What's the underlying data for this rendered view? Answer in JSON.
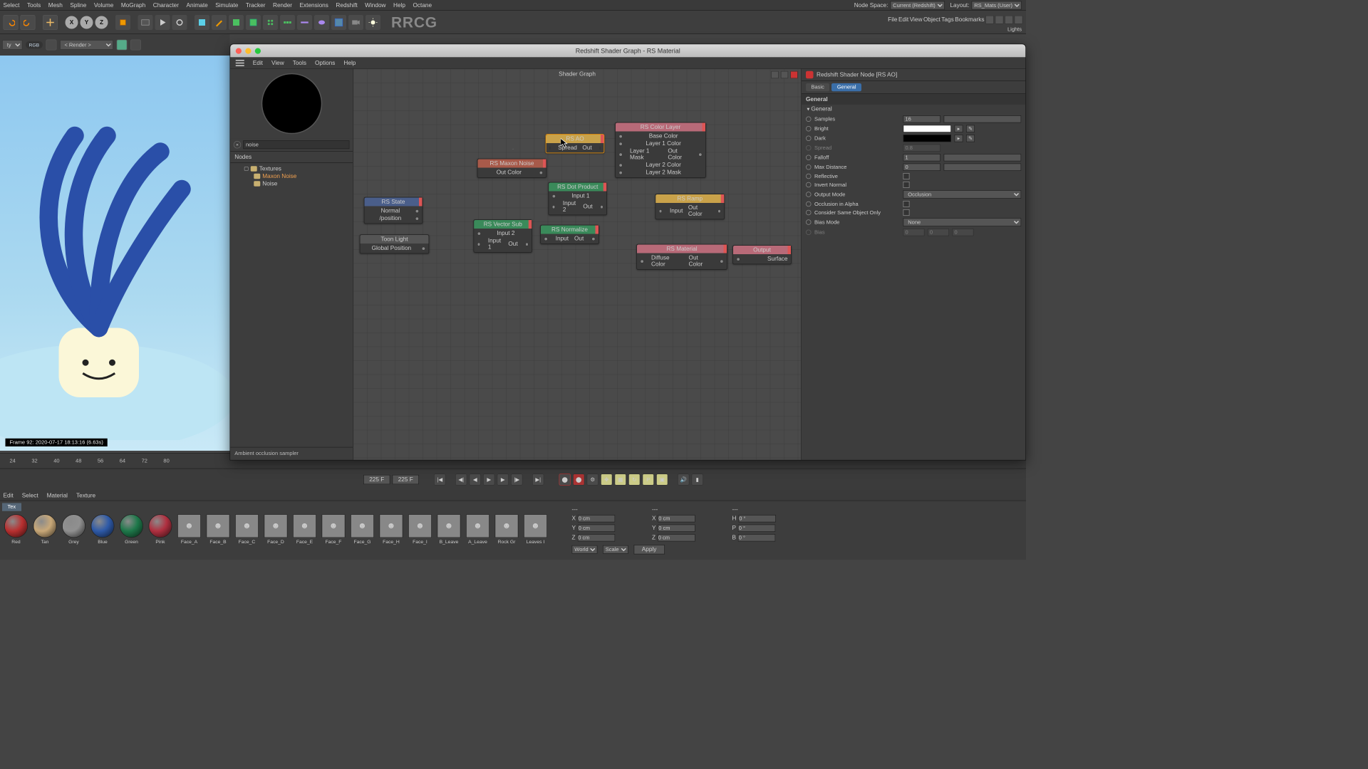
{
  "main_menu": [
    "Select",
    "Tools",
    "Mesh",
    "Spline",
    "Volume",
    "MoGraph",
    "Character",
    "Animate",
    "Simulate",
    "Tracker",
    "Render",
    "Extensions",
    "Redshift",
    "Window",
    "Help",
    "Octane"
  ],
  "top_right": {
    "node_space_label": "Node Space:",
    "node_space_value": "Current (Redshift)",
    "layout_label": "Layout:",
    "layout_value": "RS_Mats (User)"
  },
  "obj_menu": [
    "File",
    "Edit",
    "View",
    "Object",
    "Tags",
    "Bookmarks"
  ],
  "obj_tree_item": "Lights",
  "brand": "RRCG",
  "axes": [
    "X",
    "Y",
    "Z"
  ],
  "viewport": {
    "dropdown_left": "ty",
    "rgb": "RGB",
    "render": "< Render >",
    "frame_label": "Frame  92:  2020-07-17  18:13:16  (6.63s)"
  },
  "timeline": {
    "ticks": [
      "24",
      "32",
      "40",
      "48",
      "56",
      "64",
      "72",
      "80"
    ],
    "cur": "225 F",
    "end": "225 F"
  },
  "sg": {
    "title": "Redshift Shader Graph - RS Material",
    "menu": [
      "Edit",
      "View",
      "Tools",
      "Options",
      "Help"
    ],
    "search": "noise",
    "nodes_head": "Nodes",
    "tree": {
      "textures": "Textures",
      "maxon": "Maxon Noise",
      "noise": "Noise"
    },
    "canvas_title": "Shader Graph",
    "status": "Ambient occlusion sampler",
    "attr_title": "Redshift Shader Node [RS AO]",
    "tabs": {
      "basic": "Basic",
      "general": "General"
    },
    "section": "General",
    "sub": "General",
    "params": {
      "samples": {
        "l": "Samples",
        "v": "16"
      },
      "bright": {
        "l": "Bright"
      },
      "dark": {
        "l": "Dark"
      },
      "spread": {
        "l": "Spread",
        "v": "0.8"
      },
      "falloff": {
        "l": "Falloff",
        "v": "1"
      },
      "maxdist": {
        "l": "Max Distance",
        "v": "0"
      },
      "reflective": {
        "l": "Reflective"
      },
      "invert": {
        "l": "Invert Normal"
      },
      "outmode": {
        "l": "Output Mode",
        "v": "Occlusion"
      },
      "occalpha": {
        "l": "Occlusion in Alpha"
      },
      "sameobj": {
        "l": "Consider Same Object Only"
      },
      "biasmode": {
        "l": "Bias Mode",
        "v": "None"
      },
      "bias": {
        "l": "Bias",
        "v": "0",
        "v2": "0",
        "v3": "0"
      }
    },
    "nodes": {
      "state": {
        "t": "RS State",
        "r": [
          "Normal",
          "/position"
        ]
      },
      "toon": {
        "t": "Toon Light",
        "r": [
          "Global Position"
        ]
      },
      "vec": {
        "t": "RS Vector Sub",
        "r": [
          "Input 2",
          "Input 1",
          "Out"
        ]
      },
      "norm": {
        "t": "RS Normalize",
        "r": [
          "Input",
          "Out"
        ]
      },
      "dot": {
        "t": "RS Dot Product",
        "r": [
          "Input 1",
          "Input 2",
          "Out"
        ]
      },
      "ao": {
        "t": "RS AO",
        "r": [
          "Spread",
          "Out"
        ]
      },
      "noise": {
        "t": "RS Maxon Noise",
        "r": [
          "Out Color"
        ]
      },
      "color": {
        "t": "RS Color Layer",
        "r": [
          "Base Color",
          "Layer 1 Color",
          "Layer 1 Mask",
          "Layer 2 Color",
          "Layer 2 Mask",
          "Out Color"
        ]
      },
      "ramp": {
        "t": "RS Ramp",
        "r": [
          "Input",
          "Out Color"
        ]
      },
      "mat": {
        "t": "RS Material",
        "r": [
          "Diffuse Color",
          "Out Color"
        ]
      },
      "out": {
        "t": "Output",
        "r": [
          "Surface"
        ]
      }
    }
  },
  "matbar": [
    "Edit",
    "Select",
    "Material",
    "Texture"
  ],
  "tex_tab": "Tex",
  "swatches": [
    {
      "n": "Red",
      "c": "#b83030"
    },
    {
      "n": "Tan",
      "c": "#c8a878"
    },
    {
      "n": "Grey",
      "c": "#909090"
    },
    {
      "n": "Blue",
      "c": "#2e5aa8"
    },
    {
      "n": "Green",
      "c": "#1e784a"
    },
    {
      "n": "Pink",
      "c": "#b03040"
    }
  ],
  "faces": [
    "Face_A",
    "Face_B",
    "Face_C",
    "Face_D",
    "Face_E",
    "Face_F",
    "Face_G",
    "Face_H",
    "Face_I",
    "B_Leave",
    "A_Leave",
    "Rock Gr",
    "Leaves I"
  ],
  "coord": {
    "dash": "---",
    "dash2": "---",
    "X": "X",
    "Y": "Y",
    "Z": "Z",
    "H": "H",
    "P": "P",
    "B": "B",
    "val": "0 cm",
    "deg": "0 °",
    "world": "World",
    "scale": "Scale",
    "apply": "Apply"
  }
}
